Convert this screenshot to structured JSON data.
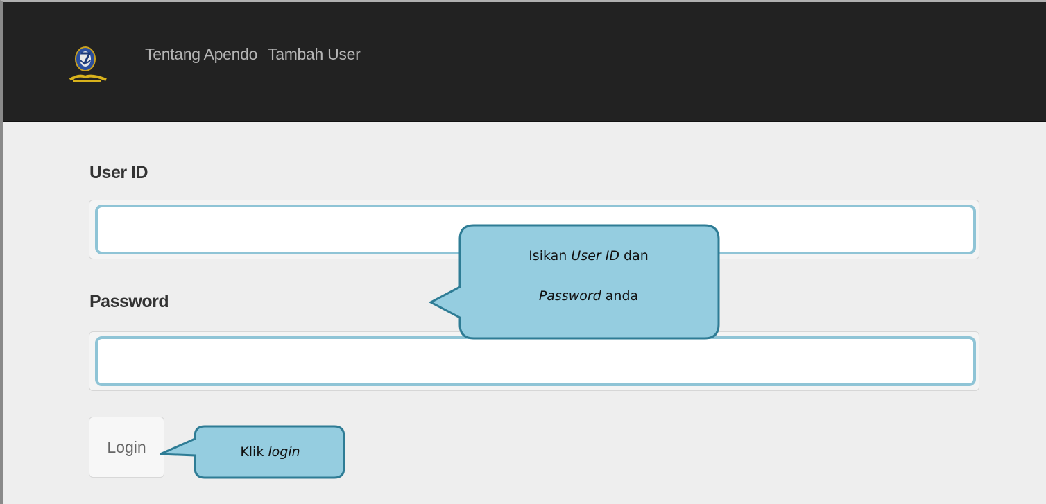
{
  "navbar": {
    "logo_icon": "emblem-logo-icon",
    "links": [
      "Tentang Apendo",
      "Tambah User"
    ],
    "background": "#222222"
  },
  "form": {
    "user_label": "User ID",
    "user_value": "",
    "password_label": "Password",
    "password_value": "",
    "login_label": "Login",
    "input_border_color": "#8fc4d6"
  },
  "callouts": {
    "main": {
      "line1_prefix": "Isikan ",
      "line1_em": "User ID",
      "line1_suffix": " dan",
      "line2_em": "Password",
      "line2_suffix": " anda"
    },
    "login": {
      "prefix": "Klik ",
      "em": "login"
    },
    "fill_color": "#95cde0",
    "stroke_color": "#2e7c95"
  }
}
